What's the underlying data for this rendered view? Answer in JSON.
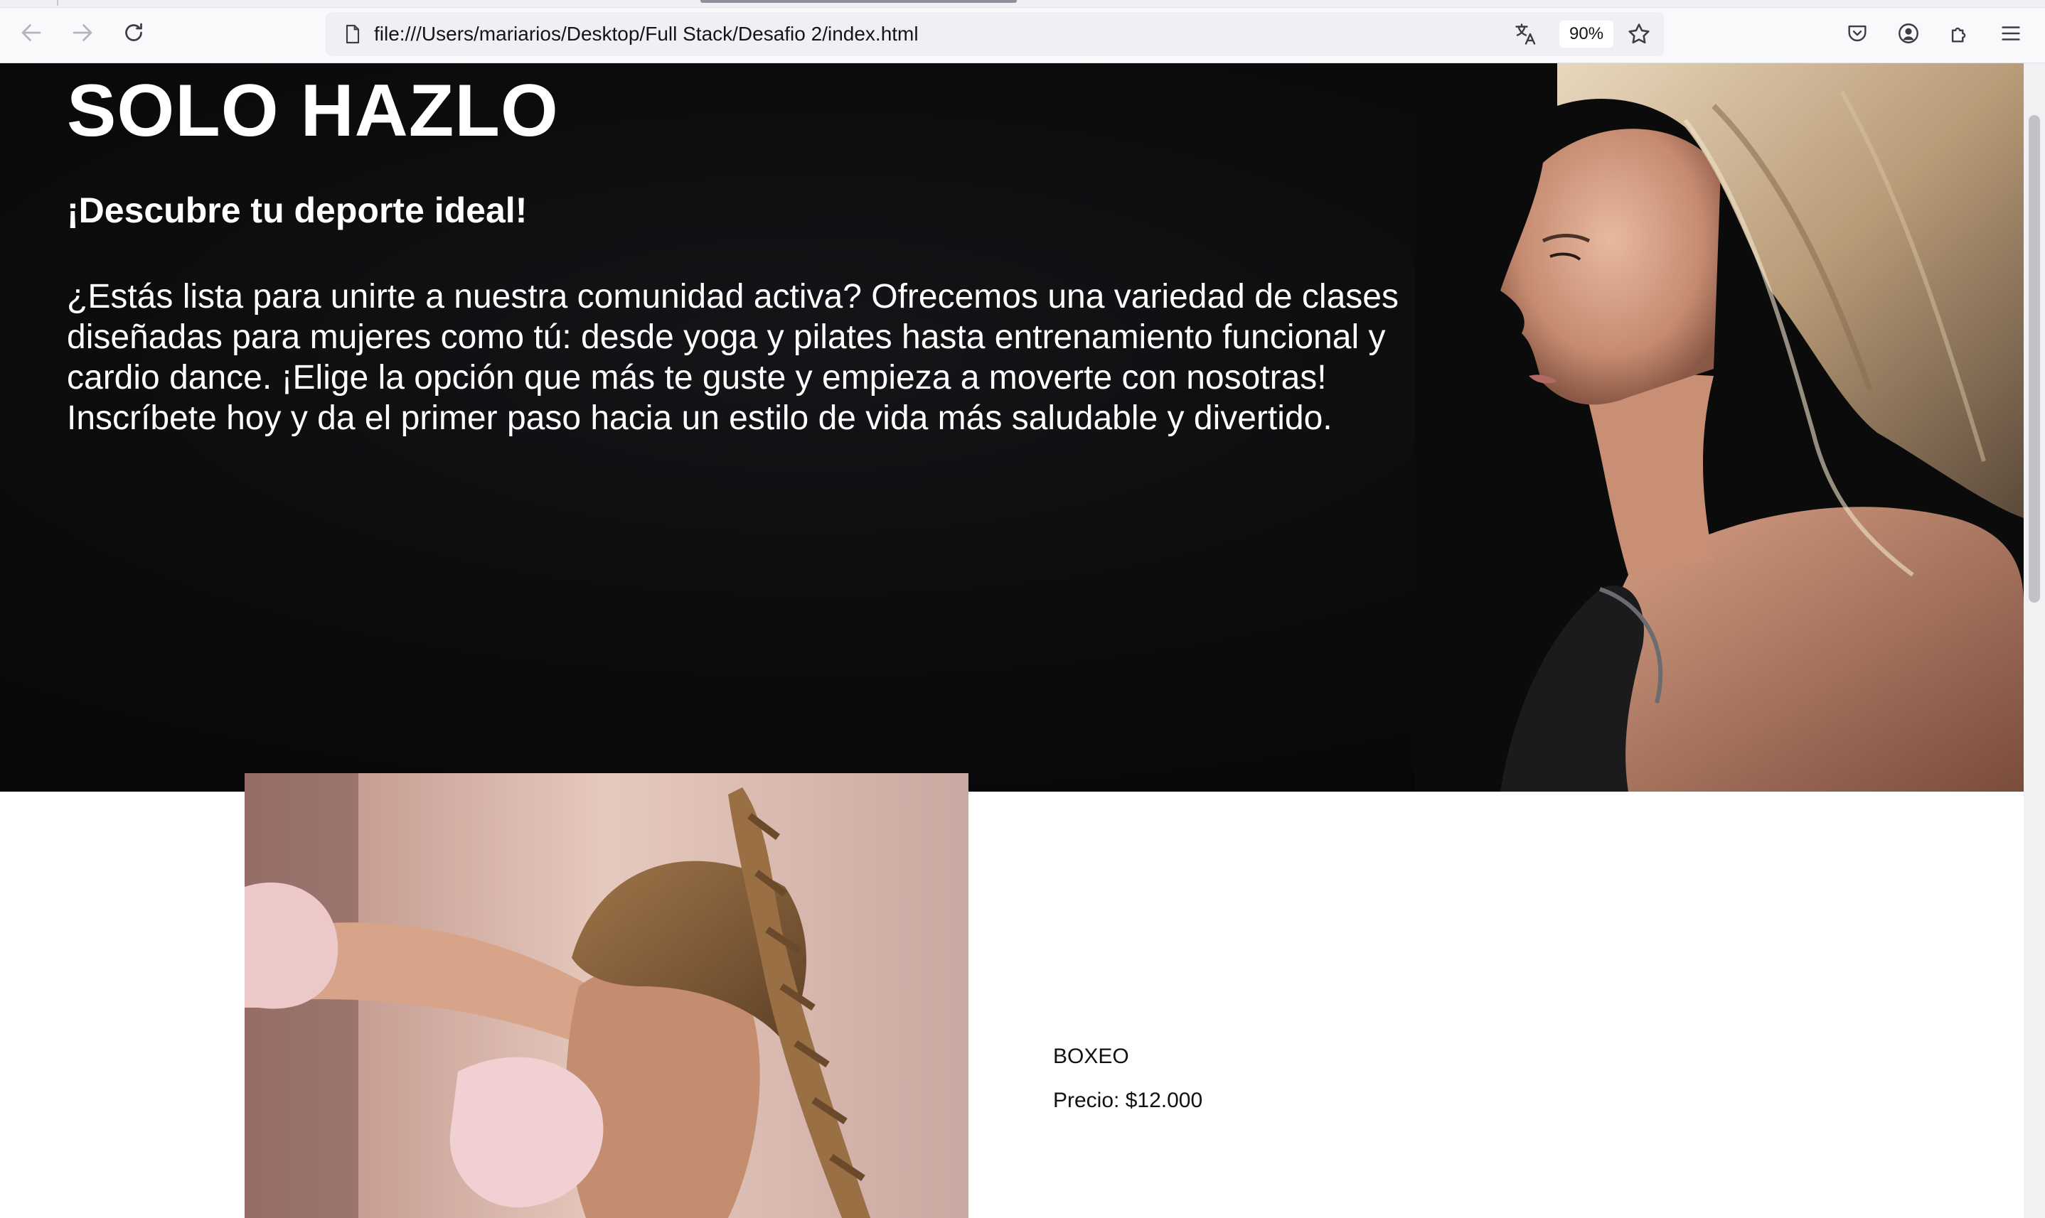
{
  "browser": {
    "url": "file:///Users/mariarios/Desktop/Full Stack/Desafio 2/index.html",
    "zoom": "90%",
    "icons": [
      "back-icon",
      "forward-icon",
      "reload-icon",
      "page-icon",
      "translate-icon",
      "bookmark-star-icon",
      "pocket-icon",
      "account-icon",
      "extensions-icon",
      "menu-icon"
    ]
  },
  "hero": {
    "title": "SOLO HAZLO",
    "subtitle": "¡Descubre tu deporte ideal!",
    "text": "¿Estás lista para unirte a nuestra comunidad activa? Ofrecemos una variedad de clases diseñadas para mujeres como tú: desde yoga y pilates hasta entrenamiento funcional y cardio dance. ¡Elige la opción que más te guste y empieza a moverte con nosotras! Inscríbete hoy y da el primer paso hacia un estilo de vida más saludable y divertido."
  },
  "product": {
    "name": "BOXEO",
    "price": "Precio: $12.000"
  },
  "colors": {
    "hero_background": "#0a0a0c",
    "text_on_dark": "#ffffff",
    "chrome_background": "#f9f9fb"
  }
}
